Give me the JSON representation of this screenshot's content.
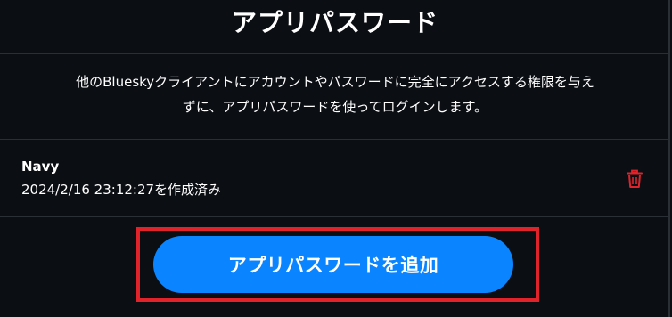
{
  "header": {
    "title": "アプリパスワード"
  },
  "description": {
    "line1": "他のBlueskyクライアントにアカウントやパスワードに完全にアクセスする権限を与え",
    "line2": "ずに、アプリパスワードを使ってログインします。"
  },
  "app_passwords": [
    {
      "name": "Navy",
      "created": "2024/2/16 23:12:27を作成済み"
    }
  ],
  "actions": {
    "add_label": "アプリパスワードを追加"
  },
  "colors": {
    "background": "#0b0e13",
    "accent": "#0a85ff",
    "delete": "#e0232b",
    "highlight": "#e0232b"
  },
  "icons": {
    "delete": "trash-icon"
  }
}
